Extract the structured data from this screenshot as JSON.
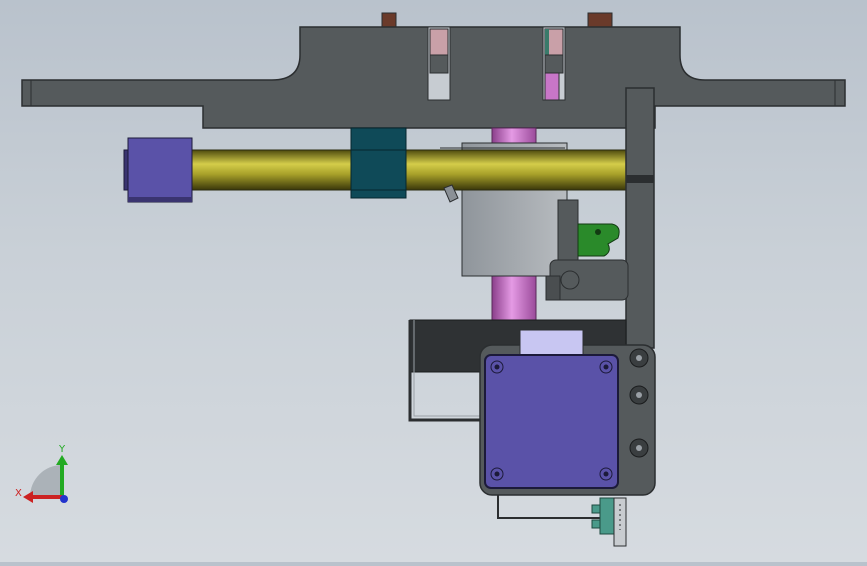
{
  "viewport": {
    "background_top": "#b9c2cc",
    "background_bottom": "#d6dbe0"
  },
  "colors": {
    "frame_gray": "#555a5c",
    "frame_edge": "#2b2e30",
    "rod_gold": "#8f8a1e",
    "rod_highlight": "#d4cd4a",
    "motor_blue": "#5a52a8",
    "coupling_teal": "#0f4a58",
    "shaft_pink": "#c876c8",
    "block_gray": "#a9adb2",
    "switch_green": "#2a8a2a",
    "connector_teal": "#4a9a8a"
  },
  "triad": {
    "x_label": "X",
    "y_label": "Y",
    "x_color": "#cc2222",
    "y_color": "#22aa22",
    "z_color": "#2233cc"
  }
}
